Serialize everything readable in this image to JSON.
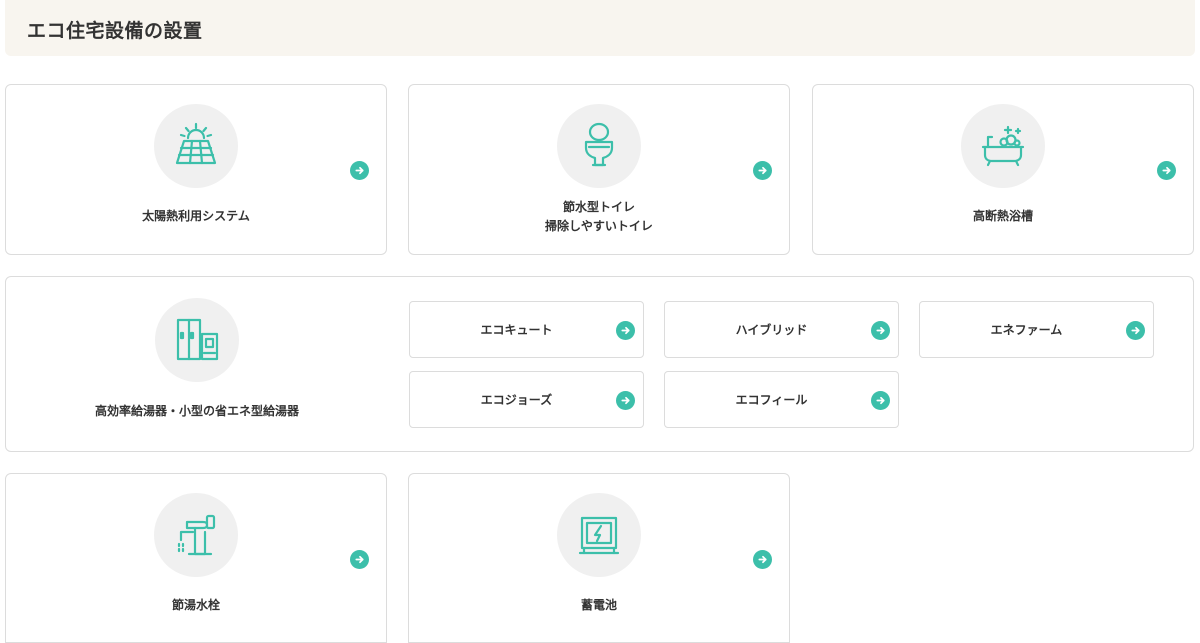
{
  "header": {
    "title": "エコ住宅設備の設置"
  },
  "cards": {
    "solar": {
      "label": "太陽熱利用システム"
    },
    "toilet": {
      "label_line1": "節水型トイレ",
      "label_line2": "掃除しやすいトイレ"
    },
    "bath": {
      "label": "高断熱浴槽"
    },
    "heater": {
      "label": "高効率給湯器・小型の省エネ型給湯器"
    },
    "faucet": {
      "label": "節湯水栓"
    },
    "battery": {
      "label": "蓄電池"
    }
  },
  "heater_options": [
    {
      "label": "エコキュート"
    },
    {
      "label": "ハイブリッド"
    },
    {
      "label": "エネファーム"
    },
    {
      "label": "エコジョーズ"
    },
    {
      "label": "エコフィール"
    }
  ],
  "colors": {
    "accent": "#3cbfaa",
    "header_bg": "#f8f5ef",
    "icon_bg": "#f0f0f0",
    "border": "#dcdcdc"
  },
  "icons": [
    "solar-panel-icon",
    "toilet-icon",
    "bathtub-icon",
    "water-heater-icon",
    "faucet-icon",
    "battery-icon",
    "arrow-right-icon"
  ]
}
